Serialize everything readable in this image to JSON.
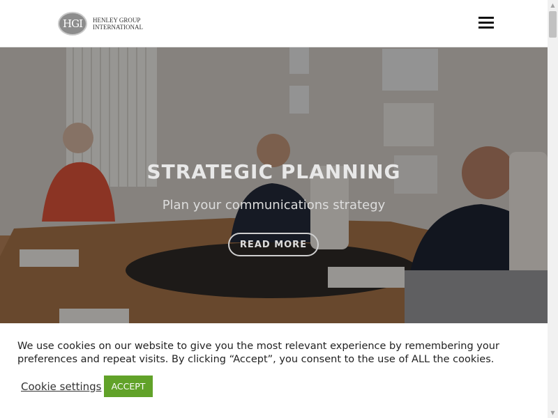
{
  "header": {
    "logo_mark": "HGI",
    "logo_text": "HENLEY GROUP INTERNATIONAL",
    "menu_icon": "hamburger-menu-icon"
  },
  "hero": {
    "title": "STRATEGIC PLANNING",
    "subtitle": "Plan your communications strategy",
    "button_label": "READ MORE"
  },
  "cookie_bar": {
    "message": "We use cookies on our website to give you the most relevant experience by remembering your preferences and repeat visits. By clicking “Accept”, you consent to the use of ALL the cookies.",
    "settings_label": "Cookie settings",
    "accept_label": "ACCEPT",
    "accept_color": "#61a229"
  }
}
